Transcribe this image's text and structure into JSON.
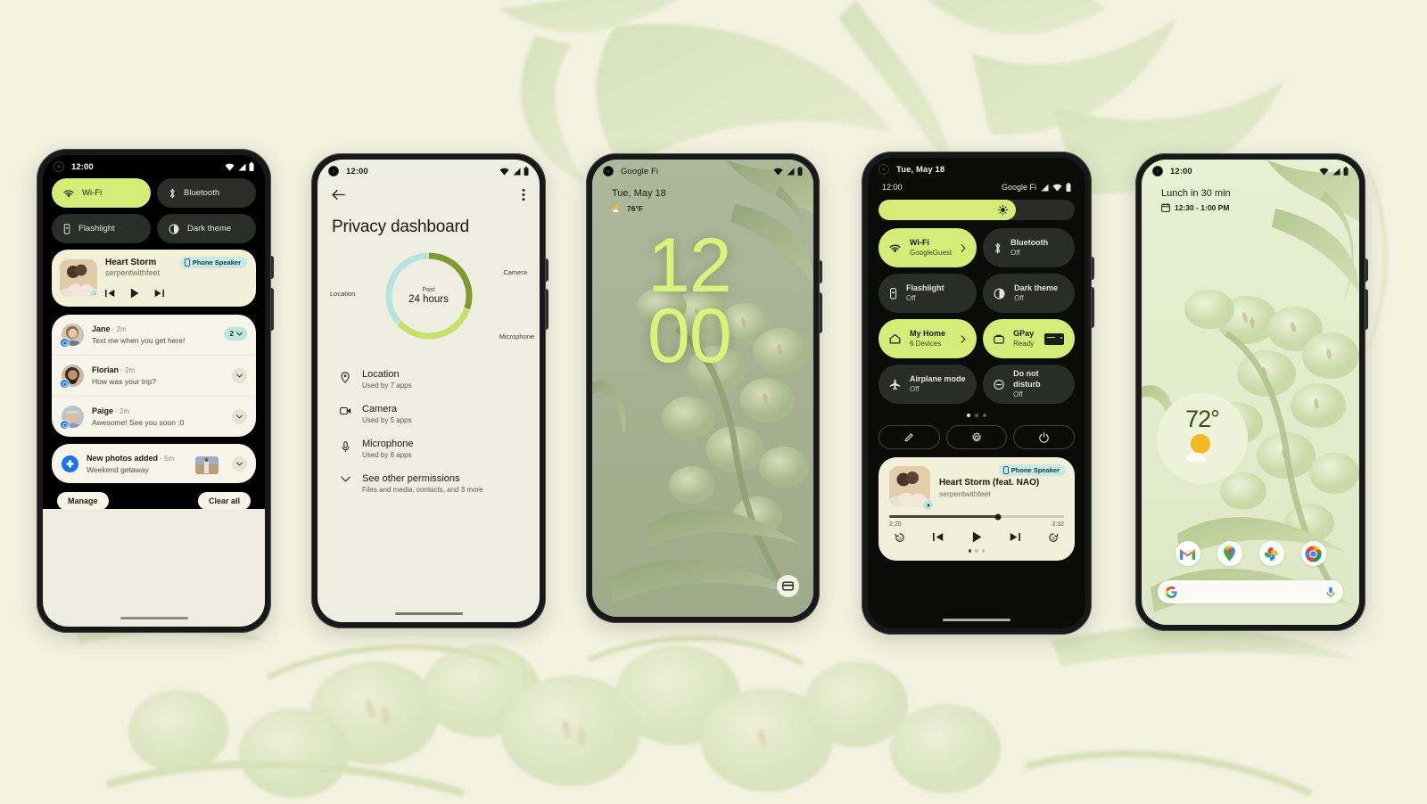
{
  "page": {
    "background_color": "#F3F2E1",
    "accent_green": "#D5EC79",
    "accent_lime_clock": "#D9F47C"
  },
  "phone1": {
    "name": "notification-shade",
    "status": {
      "time": "12:00"
    },
    "quick_tiles": [
      {
        "label": "Wi-Fi",
        "icon": "wifi-icon",
        "state": "on"
      },
      {
        "label": "Bluetooth",
        "icon": "bluetooth-icon",
        "state": "off"
      },
      {
        "label": "Flashlight",
        "icon": "flashlight-icon",
        "state": "off"
      },
      {
        "label": "Dark theme",
        "icon": "contrast-icon",
        "state": "off"
      }
    ],
    "media": {
      "title": "Heart Storm",
      "artist": "serpentwithfeet",
      "output_chip": "Phone Speaker",
      "output_icon": "phone-icon",
      "prev_icon": "skip-previous-icon",
      "play_icon": "play-icon",
      "next_icon": "skip-next-icon"
    },
    "notifications": [
      {
        "sender": "Jane",
        "time": "2m",
        "text": "Text me when you get here!",
        "badge": "2",
        "app": "messages"
      },
      {
        "sender": "Florian",
        "time": "2m",
        "text": "How was your trip?",
        "badge": "",
        "app": "messages"
      },
      {
        "sender": "Paige",
        "time": "2m",
        "text": "Awesome! See you soon :0",
        "badge": "",
        "app": "messages"
      }
    ],
    "photo_notification": {
      "title": "New photos added",
      "time": "5m",
      "text": "Weekend getaway",
      "app": "photos"
    },
    "actions": {
      "manage": "Manage",
      "clear_all": "Clear all"
    }
  },
  "phone2": {
    "name": "privacy-dashboard",
    "status": {
      "time": "12:00"
    },
    "back_icon": "arrow-back-icon",
    "overflow_icon": "more-vert-icon",
    "title": "Privacy dashboard",
    "chart_data": {
      "type": "pie",
      "title": "Privacy dashboard usage",
      "center_label_small": "Past",
      "center_label_big": "24 hours",
      "labels": [
        "Camera",
        "Microphone",
        "Location"
      ],
      "values": [
        30,
        33,
        37
      ],
      "colors": [
        "#7E9B2E",
        "#C7E06B",
        "#B7E3DD"
      ],
      "legend": "around-ring"
    },
    "permissions": [
      {
        "name": "Location",
        "sub": "Used by 7 apps",
        "icon": "location-pin-icon"
      },
      {
        "name": "Camera",
        "sub": "Used by 5 apps",
        "icon": "camera-icon"
      },
      {
        "name": "Microphone",
        "sub": "Used by 6 apps",
        "icon": "microphone-icon"
      }
    ],
    "see_other": {
      "name": "See other permissions",
      "sub": "Files and media, contacts, and 3 more",
      "icon": "chevron-down-icon"
    }
  },
  "phone3": {
    "name": "lock-screen",
    "status": {
      "carrier": "Google Fi"
    },
    "date": "Tue, May 18",
    "temperature": "76°F",
    "weather_icon": "partly-sunny-icon",
    "clock_hours": "12",
    "clock_minutes": "00",
    "wallet_icon": "wallet-card-icon"
  },
  "phone4": {
    "name": "quick-settings",
    "status": {
      "date": "Tue, May 18"
    },
    "secondary_status": {
      "time": "12:00",
      "carrier": "Google Fi"
    },
    "brightness": {
      "icon": "brightness-icon",
      "percent": 70
    },
    "tiles": [
      {
        "label": "Wi-Fi",
        "sub": "GoogleGuest",
        "icon": "wifi-icon",
        "state": "on",
        "trailing": "chevron-right-icon"
      },
      {
        "label": "Bluetooth",
        "sub": "Off",
        "icon": "bluetooth-icon",
        "state": "off",
        "trailing": ""
      },
      {
        "label": "Flashlight",
        "sub": "Off",
        "icon": "flashlight-icon",
        "state": "off",
        "trailing": ""
      },
      {
        "label": "Dark theme",
        "sub": "Off",
        "icon": "contrast-icon",
        "state": "off",
        "trailing": ""
      },
      {
        "label": "My Home",
        "sub": "6 Devices",
        "icon": "home-icon",
        "state": "on",
        "trailing": "chevron-right-icon"
      },
      {
        "label": "GPay",
        "sub": "Ready",
        "icon": "wallet-icon",
        "state": "on",
        "trailing": "card-art"
      },
      {
        "label": "Airplane mode",
        "sub": "Off",
        "icon": "airplane-icon",
        "state": "off",
        "trailing": ""
      },
      {
        "label": "Do not disturb",
        "sub": "Off",
        "icon": "do-not-disturb-icon",
        "state": "off",
        "trailing": ""
      }
    ],
    "footer_buttons": [
      {
        "icon": "edit-pencil-icon"
      },
      {
        "icon": "settings-gear-icon"
      },
      {
        "icon": "power-icon"
      }
    ],
    "media": {
      "title": "Heart Storm (feat. NAO)",
      "artist": "serpentwithfeet",
      "output_chip": "Phone Speaker",
      "output_icon": "phone-icon",
      "elapsed": "2:20",
      "duration": "3:32",
      "progress_percent": 62,
      "controls": [
        "replay-10-icon",
        "skip-previous-icon",
        "play-icon",
        "skip-next-icon",
        "forward-30-icon"
      ]
    }
  },
  "phone5": {
    "name": "home-screen",
    "status": {
      "time": "12:00"
    },
    "at_a_glance": {
      "title": "Lunch in 30 min",
      "time_range": "12:30 - 1:00 PM",
      "icon": "calendar-icon"
    },
    "weather_widget": {
      "temperature": "72°",
      "icon": "partly-sunny-icon"
    },
    "dock_apps": [
      {
        "name": "Gmail",
        "icon": "gmail-icon"
      },
      {
        "name": "Maps",
        "icon": "maps-icon"
      },
      {
        "name": "Photos",
        "icon": "photos-icon"
      },
      {
        "name": "Chrome",
        "icon": "chrome-icon"
      }
    ],
    "search_bar": {
      "leading_icon": "google-g-icon",
      "trailing_icon": "microphone-icon"
    }
  }
}
